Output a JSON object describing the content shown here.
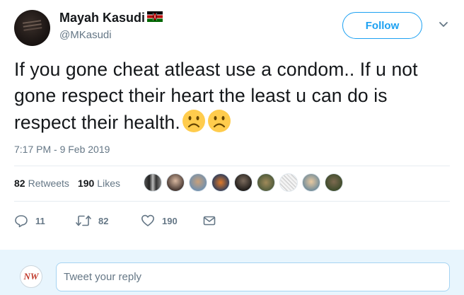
{
  "author": {
    "display_name": "Mayah Kasudi",
    "handle": "@MKasudi",
    "flag_icon": "kenya-flag-icon"
  },
  "follow_label": "Follow",
  "tweet": {
    "text": "If you gone cheat atleast use a condom.. If u not gone respect their heart the least u can do is respect their health.",
    "timestamp": "7:17 PM - 9 Feb 2019"
  },
  "stats": {
    "retweets_count": "82",
    "retweets_label": "Retweets",
    "likes_count": "190",
    "likes_label": "Likes"
  },
  "actions": {
    "reply_count": "11",
    "retweet_count": "82",
    "like_count": "190"
  },
  "reply": {
    "placeholder": "Tweet your reply",
    "avatar_text": "NW"
  },
  "colors": {
    "accent": "#1da1f2",
    "secondary_text": "#657786",
    "reply_bar_bg": "#e8f5fd"
  }
}
